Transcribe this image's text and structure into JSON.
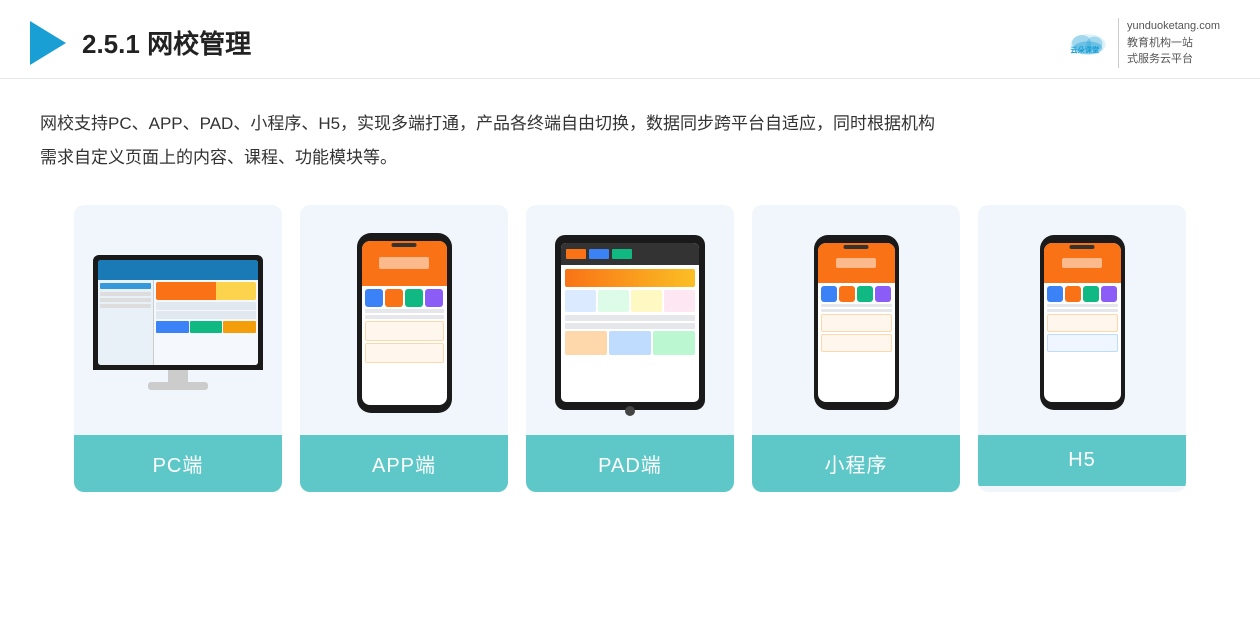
{
  "header": {
    "section_number": "2.5.1",
    "title": "网校管理",
    "brand_url": "yunduoketang.com",
    "brand_line1": "教育机构一站",
    "brand_line2": "式服务云平台"
  },
  "description": {
    "line1": "网校支持PC、APP、PAD、小程序、H5，实现多端打通，产品各终端自由切换，数据同步跨平台自适应，同时根据机构",
    "line2": "需求自定义页面上的内容、课程、功能模块等。"
  },
  "cards": [
    {
      "id": "pc",
      "label": "PC端"
    },
    {
      "id": "app",
      "label": "APP端"
    },
    {
      "id": "pad",
      "label": "PAD端"
    },
    {
      "id": "miniprogram",
      "label": "小程序"
    },
    {
      "id": "h5",
      "label": "H5"
    }
  ],
  "card_bg_color": "#f0f6fb",
  "card_label_color": "#5ec8c8"
}
